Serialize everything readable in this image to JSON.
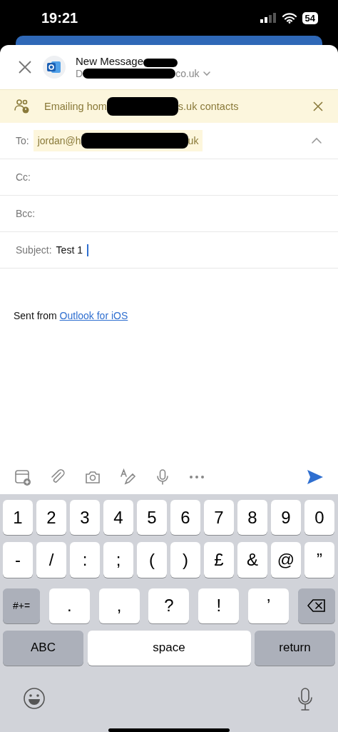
{
  "status_bar": {
    "time": "19:21",
    "battery": "54"
  },
  "compose": {
    "title": "New Message",
    "sender_start": "D",
    "sender_end": "co.uk"
  },
  "banner": {
    "text_start": "Emailing hom",
    "text_end": "s.uk contacts"
  },
  "fields": [
    {
      "kind": "recipient",
      "label": "To:",
      "value_start": "jordan@h",
      "value_end": "uk"
    },
    {
      "kind": "plain",
      "label": "Cc:"
    },
    {
      "kind": "plain",
      "label": "Bcc:"
    },
    {
      "kind": "subject",
      "label": "Subject:",
      "value": "Test 1"
    }
  ],
  "body": {
    "text": "Sent from ",
    "link": "Outlook for iOS"
  },
  "keyboard": {
    "number_keys": [
      {
        "kind": "char",
        "label": "1"
      },
      {
        "kind": "char",
        "label": "2"
      },
      {
        "kind": "char",
        "label": "3"
      },
      {
        "kind": "char",
        "label": "4"
      },
      {
        "kind": "char",
        "label": "5"
      },
      {
        "kind": "char",
        "label": "6"
      },
      {
        "kind": "char",
        "label": "7"
      },
      {
        "kind": "char",
        "label": "8"
      },
      {
        "kind": "char",
        "label": "9"
      },
      {
        "kind": "char",
        "label": "0"
      }
    ],
    "symbol_keys": [
      {
        "kind": "char",
        "label": "-"
      },
      {
        "kind": "char",
        "label": "/"
      },
      {
        "kind": "char",
        "label": ":"
      },
      {
        "kind": "char",
        "label": ";"
      },
      {
        "kind": "char",
        "label": "("
      },
      {
        "kind": "char",
        "label": ")"
      },
      {
        "kind": "char",
        "label": "£"
      },
      {
        "kind": "char",
        "label": "&"
      },
      {
        "kind": "char",
        "label": "@"
      },
      {
        "kind": "char",
        "label": "”"
      }
    ],
    "punctuation_keys": [
      {
        "kind": "function",
        "label": "#+="
      },
      {
        "kind": "wide",
        "label": "."
      },
      {
        "kind": "wide",
        "label": ","
      },
      {
        "kind": "wide",
        "label": "?"
      },
      {
        "kind": "wide",
        "label": "!"
      },
      {
        "kind": "wide",
        "label": "’"
      },
      {
        "kind": "delete"
      }
    ],
    "bottom_keys": [
      {
        "kind": "bottom",
        "label": "ABC"
      },
      {
        "kind": "space",
        "label": "space"
      },
      {
        "kind": "bottom",
        "label": "return"
      }
    ]
  }
}
